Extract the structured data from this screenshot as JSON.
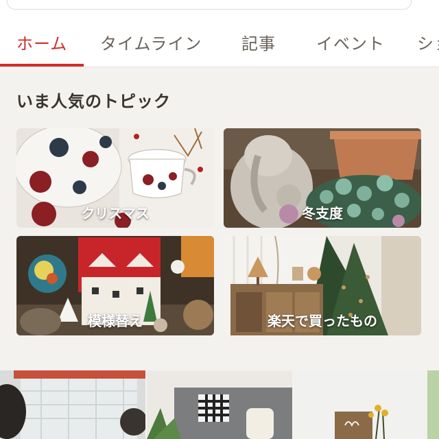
{
  "tabs": [
    {
      "label": "ホーム",
      "active": true
    },
    {
      "label": "タイムライン",
      "active": false
    },
    {
      "label": "記事",
      "active": false
    },
    {
      "label": "イベント",
      "active": false
    },
    {
      "label": "ショ",
      "active": false
    }
  ],
  "section": {
    "title": "いま人気のトピック"
  },
  "topics": [
    {
      "label": "クリスマス"
    },
    {
      "label": "冬支度"
    },
    {
      "label": "模様替え"
    },
    {
      "label": "楽天で買ったもの"
    }
  ],
  "colors": {
    "accent": "#d32c26",
    "tab_text": "#6a625b",
    "background": "#f4f2ef"
  },
  "icons": []
}
